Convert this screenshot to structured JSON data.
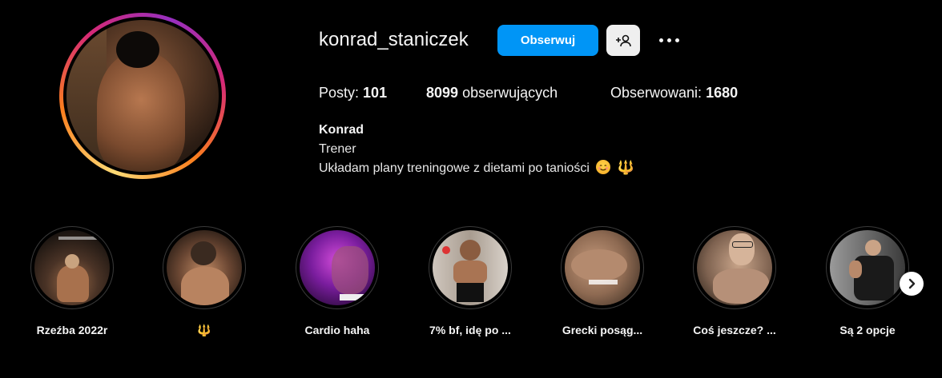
{
  "profile": {
    "username": "konrad_staniczek",
    "follow_label": "Obserwuj",
    "full_name": "Konrad",
    "category": "Trener",
    "bio": "Układam plany treningowe z dietami po taniości"
  },
  "stats": {
    "posts_label": "Posty:",
    "posts_value": "101",
    "followers_value": "8099",
    "followers_label": "obserwujących",
    "following_label": "Obserwowani:",
    "following_value": "1680"
  },
  "highlights": [
    {
      "label": "Rzeźba 2022r"
    },
    {
      "label": "🔱"
    },
    {
      "label": "Cardio haha"
    },
    {
      "label": "7% bf, idę po ..."
    },
    {
      "label": "Grecki posąg..."
    },
    {
      "label": "Coś jeszcze? ..."
    },
    {
      "label": "Są 2 opcje"
    }
  ],
  "colors": {
    "accent": "#0095f6",
    "background": "#000000",
    "emoji_gold": "#f5a623"
  }
}
